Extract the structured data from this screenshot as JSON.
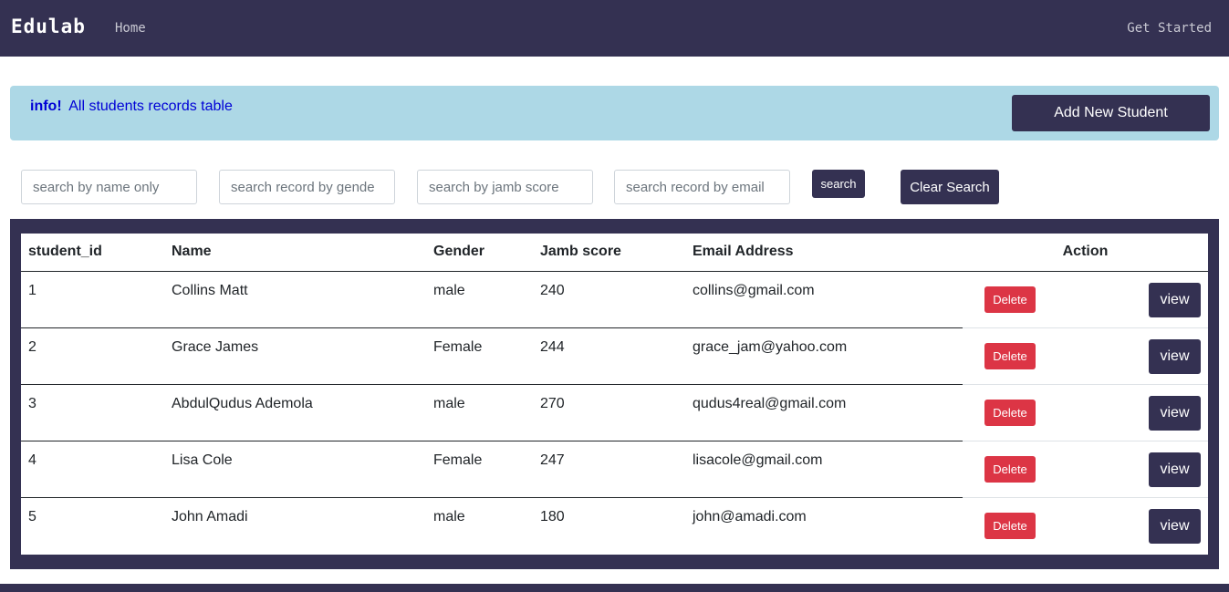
{
  "navbar": {
    "brand": "Edulab",
    "home": "Home",
    "get_started": "Get Started"
  },
  "info": {
    "label": "info!",
    "text": "All students records table",
    "add_button": "Add New Student"
  },
  "search": {
    "name_placeholder": "search by name only",
    "gender_placeholder": "search record by gende",
    "jamb_placeholder": "search by jamb score",
    "email_placeholder": "search record by email",
    "search_button": "search",
    "clear_button": "Clear Search"
  },
  "table": {
    "headers": [
      "student_id",
      "Name",
      "Gender",
      "Jamb score",
      "Email Address",
      "Action"
    ],
    "delete_label": "Delete",
    "view_label": "view",
    "rows": [
      {
        "id": "1",
        "name": "Collins Matt",
        "gender": "male",
        "jamb": "240",
        "email": "collins@gmail.com"
      },
      {
        "id": "2",
        "name": "Grace James",
        "gender": "Female",
        "jamb": "244",
        "email": "grace_jam@yahoo.com"
      },
      {
        "id": "3",
        "name": "AbdulQudus Ademola",
        "gender": "male",
        "jamb": "270",
        "email": "qudus4real@gmail.com"
      },
      {
        "id": "4",
        "name": "Lisa Cole",
        "gender": "Female",
        "jamb": "247",
        "email": "lisacole@gmail.com"
      },
      {
        "id": "5",
        "name": "John Amadi",
        "gender": "male",
        "jamb": "180",
        "email": "john@amadi.com"
      }
    ]
  },
  "colors": {
    "primary": "#343152",
    "info_bg": "#add8e6",
    "danger": "#dc3545"
  }
}
